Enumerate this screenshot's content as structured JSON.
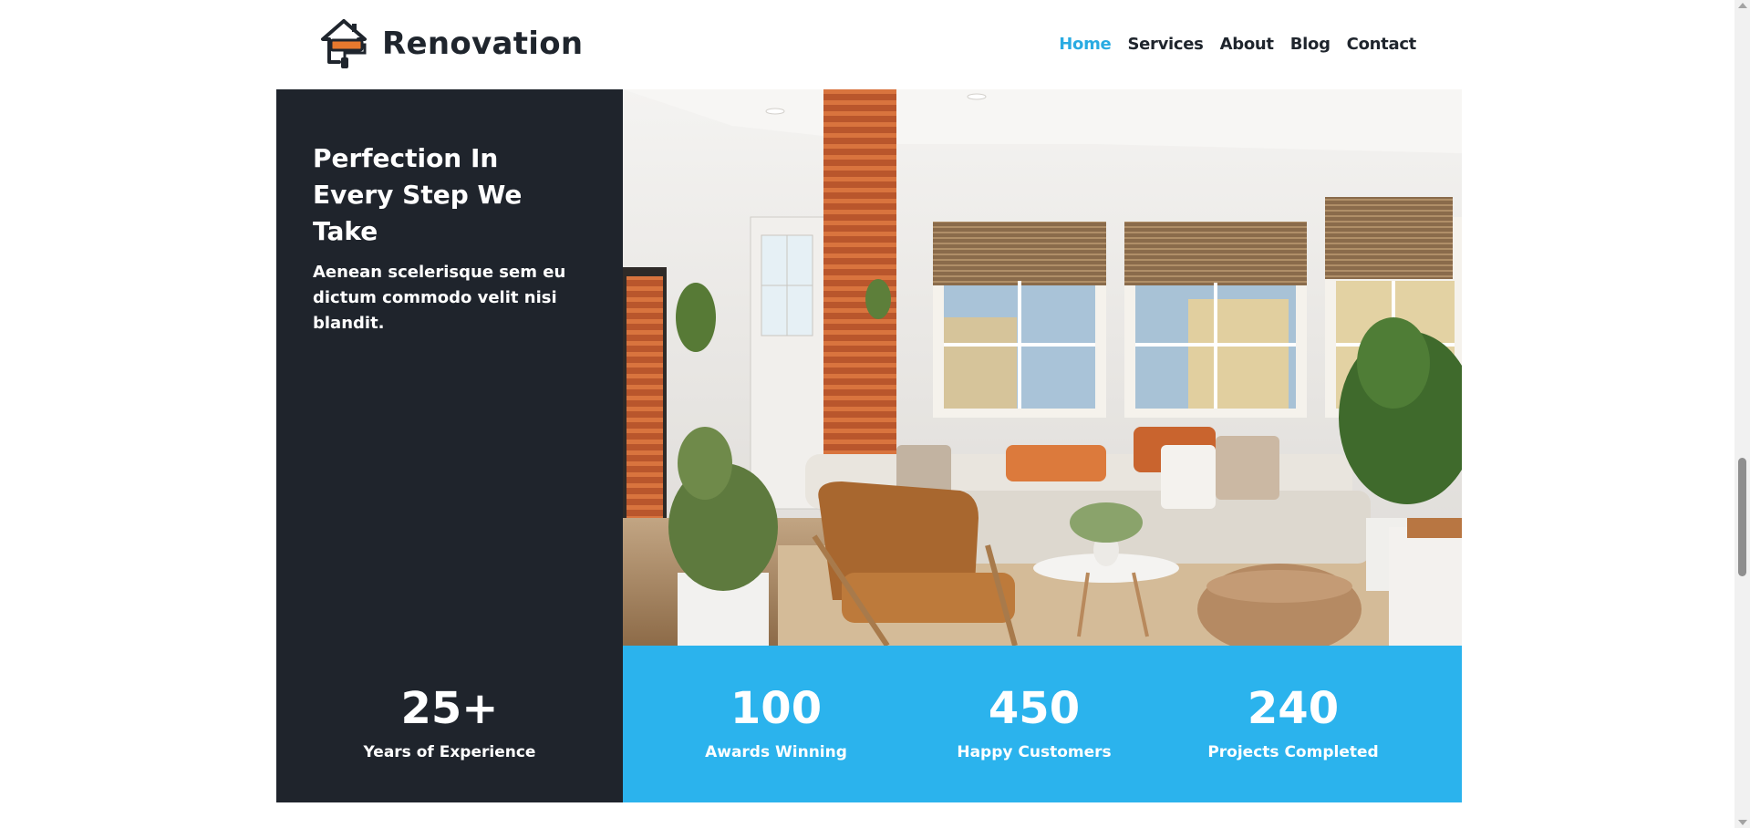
{
  "header": {
    "brand": "Renovation",
    "logo_icon": "house-paint-roller-icon",
    "nav": [
      {
        "label": "Home",
        "active": true
      },
      {
        "label": "Services",
        "active": false
      },
      {
        "label": "About",
        "active": false
      },
      {
        "label": "Blog",
        "active": false
      },
      {
        "label": "Contact",
        "active": false
      }
    ]
  },
  "hero": {
    "heading": "Perfection In Every Step We Take",
    "text": "Aenean scelerisque sem eu dictum commodo velit nisi blandit."
  },
  "stats": [
    {
      "number": "25+",
      "label": "Years of Experience"
    },
    {
      "number": "100",
      "label": "Awards Winning"
    },
    {
      "number": "450",
      "label": "Happy Customers"
    },
    {
      "number": "240",
      "label": "Projects Completed"
    }
  ],
  "colors": {
    "accent": "#29abe2",
    "stats_background": "#2bb3ed",
    "dark_panel": "#1f242c",
    "text_dark": "#1f252d"
  }
}
